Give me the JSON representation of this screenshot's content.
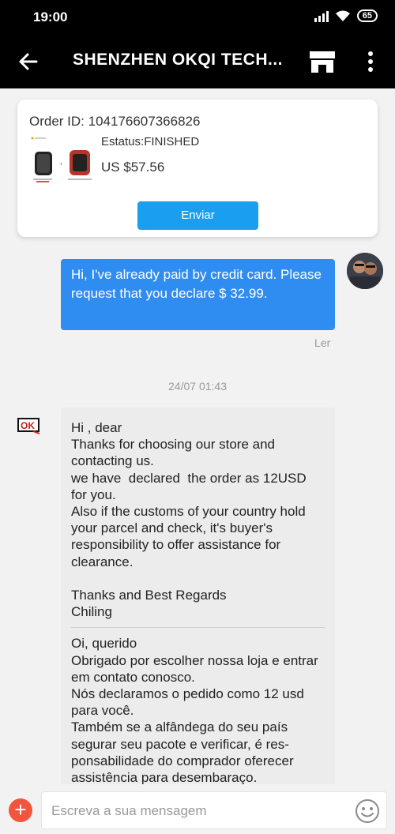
{
  "status_bar": {
    "time": "19:00",
    "battery": "65"
  },
  "header": {
    "title": "SHENZHEN OKQI TECH..."
  },
  "order": {
    "id_label": "Order ID: 104176607366826",
    "status": "Estatus:FINISHED",
    "price": "US $57.56",
    "send_label": "Enviar"
  },
  "messages": {
    "outgoing": {
      "text": "Hi, I've already paid by credit card. Please request that you declare $ 32.99.",
      "read_label": "Ler"
    },
    "date_separator": "24/07 01:43",
    "incoming": {
      "english": "Hi , dear\nThanks for choosing our store and contacting us.\nwe have  declared  the order as 12USD for you.\nAlso if the customs of your country hold your parcel and check, it's buyer's responsibility to offer assistance for clearance.\n\nThanks and Best Regards\nChiling",
      "portuguese": "Oi, querido\nObrigado por escolher nossa loja e entrar em contato conosco.\nNós declaramos o pedido como 12 usd para você.\nTambém se a alfândega do seu país segurar seu pacote e verificar, é res-ponsabilidade do comprador oferecer assistência para desembaraço."
    }
  },
  "composer": {
    "placeholder": "Escreva a sua mensagem"
  },
  "icons": {
    "back": "arrow-left-icon",
    "store": "store-icon",
    "more": "more-vertical-icon",
    "add": "plus-icon",
    "emoji": "smiley-icon"
  },
  "colors": {
    "header_bg": "#000000",
    "accent_blue": "#1a9ff0",
    "outgoing_bubble": "#2f8cf1",
    "incoming_bubble": "#ececec",
    "add_button": "#f1553f"
  }
}
